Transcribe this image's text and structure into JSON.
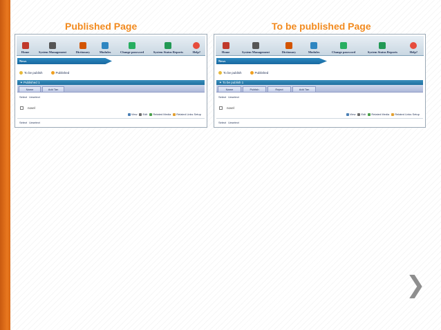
{
  "slide": {
    "left_title": "Published Page",
    "right_title": "To be published Page",
    "accent_color": "#f28a1e",
    "sidebar_color": "#e06f1a"
  },
  "left_screen": {
    "nav": [
      {
        "label": "Home",
        "icon": "home-icon",
        "color": "#c0392b"
      },
      {
        "label": "System Management",
        "icon": "tools-icon",
        "color": "#555555"
      },
      {
        "label": "Dictionary",
        "icon": "book-icon",
        "color": "#d35400"
      },
      {
        "label": "Modules",
        "icon": "modules-icon",
        "color": "#2e86c1"
      },
      {
        "label": "Change password",
        "icon": "key-icon",
        "color": "#27ae60"
      },
      {
        "label": "System Status Reports",
        "icon": "report-icon",
        "color": "#229954"
      },
      {
        "label": "Help?",
        "icon": "lifebuoy-icon",
        "color": "#e74c3c"
      }
    ],
    "banner": "News",
    "status_tabs": [
      "To be publish",
      "Published"
    ],
    "panel_title": "Published",
    "panel_count": "1",
    "columns": [
      "Name",
      "Add Tan"
    ],
    "select_label": "Select",
    "unselect_label": "Unselect",
    "item_text": "novel",
    "actions": [
      "View",
      "Edit",
      "Related Media",
      "Related Links Setup"
    ]
  },
  "right_screen": {
    "nav": [
      {
        "label": "Home",
        "icon": "home-icon",
        "color": "#c0392b"
      },
      {
        "label": "System Management",
        "icon": "tools-icon",
        "color": "#555555"
      },
      {
        "label": "Dictionary",
        "icon": "book-icon",
        "color": "#d35400"
      },
      {
        "label": "Modules",
        "icon": "modules-icon",
        "color": "#2e86c1"
      },
      {
        "label": "Change password",
        "icon": "key-icon",
        "color": "#27ae60"
      },
      {
        "label": "System Status Reports",
        "icon": "report-icon",
        "color": "#229954"
      },
      {
        "label": "Help?",
        "icon": "lifebuoy-icon",
        "color": "#e74c3c"
      }
    ],
    "banner": "News",
    "status_tabs": [
      "To be publish",
      "Published"
    ],
    "panel_title": "To be publish",
    "panel_count": "1",
    "columns": [
      "Name",
      "Publish",
      "Reject",
      "Add Tan"
    ],
    "select_label": "Select",
    "unselect_label": "Unselect",
    "item_text": "novel",
    "actions": [
      "View",
      "Edit",
      "Related Media",
      "Related Links Setup"
    ]
  },
  "next_icon": "chevron-right-icon"
}
